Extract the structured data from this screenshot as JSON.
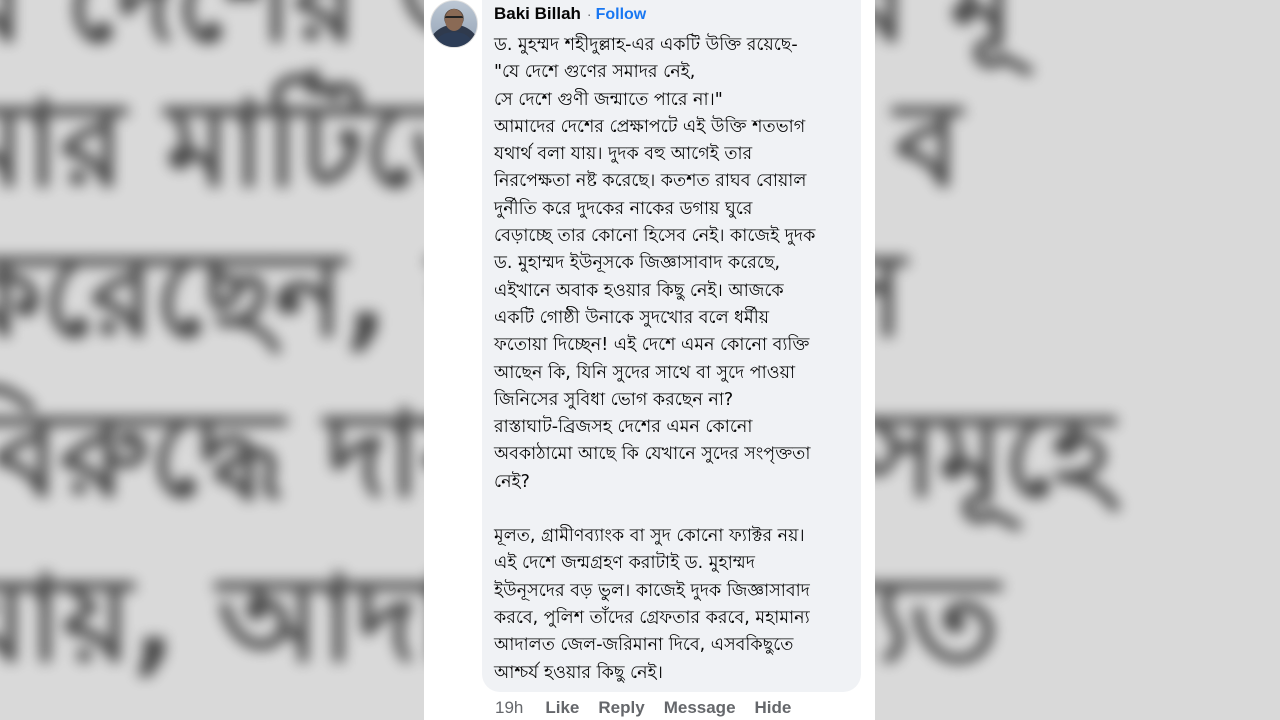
{
  "backdrop_lines": [
    "র দেশের জল গুণীর মূ",
    "মার মাটিতে মেধাবী ব",
    "করেছেন, ড. ইউনূস",
    "বিরুদ্ধে দায় মামলা সমূহে",
    "যায়, আদালত ন্যায্যত"
  ],
  "comment": {
    "author": "Baki Billah",
    "separator": "·",
    "follow_label": "Follow",
    "paragraphs": [
      "ড. মুহম্মদ শহীদুল্লাহ-এর একটি উক্তি রয়েছে-\n\"যে দেশে গুণের সমাদর নেই,\nসে দেশে গুণী জন্মাতে পারে না।\"\nআমাদের দেশের প্রেক্ষাপটে এই উক্তি শতভাগ\nযথার্থ বলা যায়। দুদক বহু আগেই তার\nনিরপেক্ষতা নষ্ট করেছে। কতশত রাঘব বোয়াল\nদুর্নীতি করে দুদকের নাকের ডগায় ঘুরে\nবেড়াচ্ছে তার কোনো হিসেব নেই। কাজেই দুদক\nড. মুহাম্মদ ইউনূসকে জিজ্ঞাসাবাদ করেছে,\nএইখানে অবাক হওয়ার কিছু নেই। আজকে\nএকটি গোষ্ঠী উনাকে সুদখোর বলে ধর্মীয়\nফতোয়া দিচ্ছেন! এই দেশে এমন কোনো ব্যক্তি\nআছেন কি, যিনি সুদের সাথে বা সুদে পাওয়া\nজিনিসের সুবিধা ভোগ করছেন না?\nরাস্তাঘাট-ব্রিজসহ দেশের এমন কোনো\nঅবকাঠামো আছে কি যেখানে সুদের সংপৃক্ততা\nনেই?",
      "মূলত, গ্রামীণব্যাংক বা সুদ কোনো ফ্যাক্টর নয়।\nএই দেশে জন্মগ্রহণ করাটাই ড. মুহাম্মদ\nইউনূসদের বড় ভুল। কাজেই দুদক জিজ্ঞাসাবাদ\nকরবে, পুলিশ তাঁদের গ্রেফতার করবে, মহামান্য\nআদালত জেল-জরিমানা দিবে, এসবকিছুতে\nআশ্চর্য হওয়ার কিছু নেই।"
    ]
  },
  "actions": {
    "time": "19h",
    "like": "Like",
    "reply": "Reply",
    "message": "Message",
    "hide": "Hide"
  },
  "colors": {
    "bubble": "#f0f2f5",
    "follow": "#1877f2",
    "meta": "#65676b"
  }
}
